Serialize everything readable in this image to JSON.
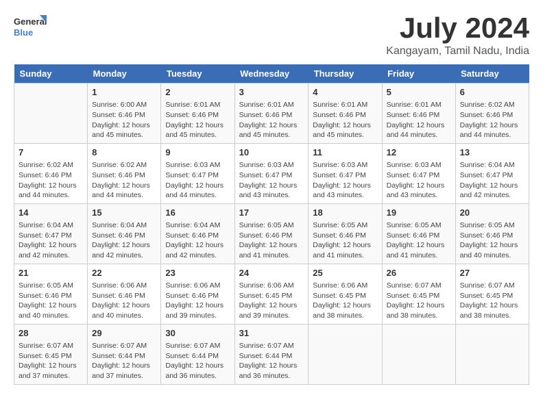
{
  "logo": {
    "line1": "General",
    "line2": "Blue"
  },
  "title": "July 2024",
  "subtitle": "Kangayam, Tamil Nadu, India",
  "days_header": [
    "Sunday",
    "Monday",
    "Tuesday",
    "Wednesday",
    "Thursday",
    "Friday",
    "Saturday"
  ],
  "weeks": [
    [
      {
        "day": "",
        "content": ""
      },
      {
        "day": "1",
        "content": "Sunrise: 6:00 AM\nSunset: 6:46 PM\nDaylight: 12 hours\nand 45 minutes."
      },
      {
        "day": "2",
        "content": "Sunrise: 6:01 AM\nSunset: 6:46 PM\nDaylight: 12 hours\nand 45 minutes."
      },
      {
        "day": "3",
        "content": "Sunrise: 6:01 AM\nSunset: 6:46 PM\nDaylight: 12 hours\nand 45 minutes."
      },
      {
        "day": "4",
        "content": "Sunrise: 6:01 AM\nSunset: 6:46 PM\nDaylight: 12 hours\nand 45 minutes."
      },
      {
        "day": "5",
        "content": "Sunrise: 6:01 AM\nSunset: 6:46 PM\nDaylight: 12 hours\nand 44 minutes."
      },
      {
        "day": "6",
        "content": "Sunrise: 6:02 AM\nSunset: 6:46 PM\nDaylight: 12 hours\nand 44 minutes."
      }
    ],
    [
      {
        "day": "7",
        "content": "Sunrise: 6:02 AM\nSunset: 6:46 PM\nDaylight: 12 hours\nand 44 minutes."
      },
      {
        "day": "8",
        "content": "Sunrise: 6:02 AM\nSunset: 6:46 PM\nDaylight: 12 hours\nand 44 minutes."
      },
      {
        "day": "9",
        "content": "Sunrise: 6:03 AM\nSunset: 6:47 PM\nDaylight: 12 hours\nand 44 minutes."
      },
      {
        "day": "10",
        "content": "Sunrise: 6:03 AM\nSunset: 6:47 PM\nDaylight: 12 hours\nand 43 minutes."
      },
      {
        "day": "11",
        "content": "Sunrise: 6:03 AM\nSunset: 6:47 PM\nDaylight: 12 hours\nand 43 minutes."
      },
      {
        "day": "12",
        "content": "Sunrise: 6:03 AM\nSunset: 6:47 PM\nDaylight: 12 hours\nand 43 minutes."
      },
      {
        "day": "13",
        "content": "Sunrise: 6:04 AM\nSunset: 6:47 PM\nDaylight: 12 hours\nand 42 minutes."
      }
    ],
    [
      {
        "day": "14",
        "content": "Sunrise: 6:04 AM\nSunset: 6:47 PM\nDaylight: 12 hours\nand 42 minutes."
      },
      {
        "day": "15",
        "content": "Sunrise: 6:04 AM\nSunset: 6:46 PM\nDaylight: 12 hours\nand 42 minutes."
      },
      {
        "day": "16",
        "content": "Sunrise: 6:04 AM\nSunset: 6:46 PM\nDaylight: 12 hours\nand 42 minutes."
      },
      {
        "day": "17",
        "content": "Sunrise: 6:05 AM\nSunset: 6:46 PM\nDaylight: 12 hours\nand 41 minutes."
      },
      {
        "day": "18",
        "content": "Sunrise: 6:05 AM\nSunset: 6:46 PM\nDaylight: 12 hours\nand 41 minutes."
      },
      {
        "day": "19",
        "content": "Sunrise: 6:05 AM\nSunset: 6:46 PM\nDaylight: 12 hours\nand 41 minutes."
      },
      {
        "day": "20",
        "content": "Sunrise: 6:05 AM\nSunset: 6:46 PM\nDaylight: 12 hours\nand 40 minutes."
      }
    ],
    [
      {
        "day": "21",
        "content": "Sunrise: 6:05 AM\nSunset: 6:46 PM\nDaylight: 12 hours\nand 40 minutes."
      },
      {
        "day": "22",
        "content": "Sunrise: 6:06 AM\nSunset: 6:46 PM\nDaylight: 12 hours\nand 40 minutes."
      },
      {
        "day": "23",
        "content": "Sunrise: 6:06 AM\nSunset: 6:46 PM\nDaylight: 12 hours\nand 39 minutes."
      },
      {
        "day": "24",
        "content": "Sunrise: 6:06 AM\nSunset: 6:45 PM\nDaylight: 12 hours\nand 39 minutes."
      },
      {
        "day": "25",
        "content": "Sunrise: 6:06 AM\nSunset: 6:45 PM\nDaylight: 12 hours\nand 38 minutes."
      },
      {
        "day": "26",
        "content": "Sunrise: 6:07 AM\nSunset: 6:45 PM\nDaylight: 12 hours\nand 38 minutes."
      },
      {
        "day": "27",
        "content": "Sunrise: 6:07 AM\nSunset: 6:45 PM\nDaylight: 12 hours\nand 38 minutes."
      }
    ],
    [
      {
        "day": "28",
        "content": "Sunrise: 6:07 AM\nSunset: 6:45 PM\nDaylight: 12 hours\nand 37 minutes."
      },
      {
        "day": "29",
        "content": "Sunrise: 6:07 AM\nSunset: 6:44 PM\nDaylight: 12 hours\nand 37 minutes."
      },
      {
        "day": "30",
        "content": "Sunrise: 6:07 AM\nSunset: 6:44 PM\nDaylight: 12 hours\nand 36 minutes."
      },
      {
        "day": "31",
        "content": "Sunrise: 6:07 AM\nSunset: 6:44 PM\nDaylight: 12 hours\nand 36 minutes."
      },
      {
        "day": "",
        "content": ""
      },
      {
        "day": "",
        "content": ""
      },
      {
        "day": "",
        "content": ""
      }
    ]
  ]
}
